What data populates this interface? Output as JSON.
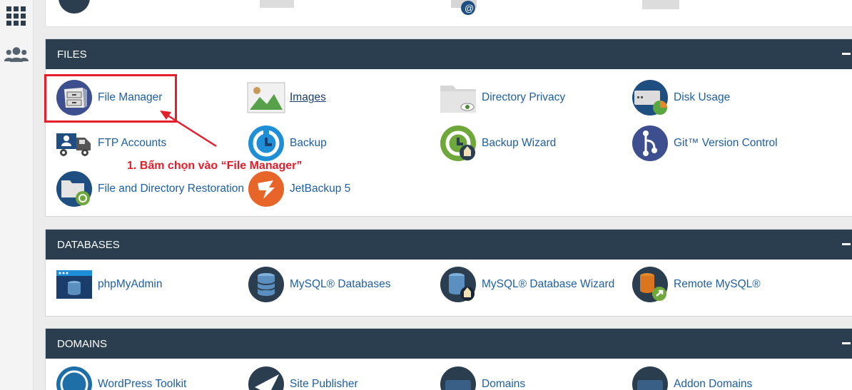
{
  "sections": {
    "files": {
      "title": "FILES",
      "items": [
        {
          "label": "File Manager"
        },
        {
          "label": "Images"
        },
        {
          "label": "Directory Privacy"
        },
        {
          "label": "Disk Usage"
        },
        {
          "label": "FTP Accounts"
        },
        {
          "label": "Backup"
        },
        {
          "label": "Backup Wizard"
        },
        {
          "label": "Git™ Version Control"
        },
        {
          "label": "File and Directory Restoration"
        },
        {
          "label": "JetBackup 5"
        }
      ]
    },
    "databases": {
      "title": "DATABASES",
      "items": [
        {
          "label": "phpMyAdmin"
        },
        {
          "label": "MySQL® Databases"
        },
        {
          "label": "MySQL® Database Wizard"
        },
        {
          "label": "Remote MySQL®"
        }
      ]
    },
    "domains": {
      "title": "DOMAINS",
      "items": [
        {
          "label": "WordPress Toolkit"
        },
        {
          "label": "Site Publisher"
        },
        {
          "label": "Domains"
        },
        {
          "label": "Addon Domains"
        }
      ]
    }
  },
  "annotation": {
    "text": "1. Bấm chọn vào “File Manager”",
    "color": "#e41e2b"
  },
  "colors": {
    "header_bg": "#2b3e50",
    "link": "#1f5fa0",
    "accent": "#e41e2b"
  },
  "icons": {
    "sidebar": [
      "grid-icon",
      "users-icon"
    ],
    "files": [
      "file-manager-icon",
      "images-icon",
      "directory-privacy-icon",
      "disk-usage-icon",
      "ftp-accounts-icon",
      "backup-icon",
      "backup-wizard-icon",
      "git-icon",
      "file-restoration-icon",
      "jetbackup-icon"
    ]
  }
}
